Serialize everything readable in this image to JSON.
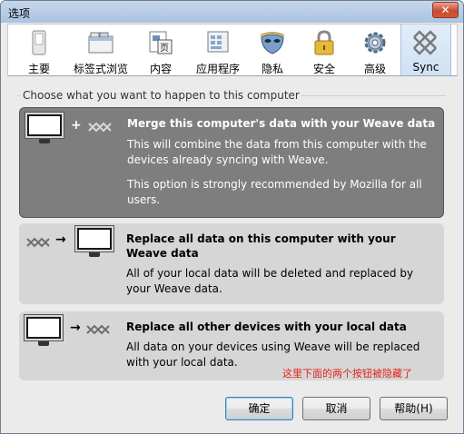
{
  "window": {
    "title": "选项",
    "close_glyph": "✕"
  },
  "toolbar": {
    "tabs": [
      {
        "label": "主要",
        "icon": "switch-icon"
      },
      {
        "label": "标签式浏览",
        "icon": "tabs-window-icon"
      },
      {
        "label": "内容",
        "icon": "content-icon"
      },
      {
        "label": "应用程序",
        "icon": "applications-icon"
      },
      {
        "label": "隐私",
        "icon": "privacy-mask-icon"
      },
      {
        "label": "安全",
        "icon": "padlock-icon"
      },
      {
        "label": "高级",
        "icon": "gear-icon"
      },
      {
        "label": "Sync",
        "icon": "weave-sync-icon"
      }
    ],
    "active_tab": "Sync"
  },
  "group": {
    "label": "Choose what you want to happen to this computer"
  },
  "options": [
    {
      "title": "Merge this computer's data with your Weave data",
      "description_1": "This will combine the data from this computer with the devices already syncing with Weave.",
      "description_2": "This option is strongly recommended by Mozilla for all users.",
      "selected": true,
      "connector": "+"
    },
    {
      "title": "Replace all data on this computer with your Weave data",
      "description_1": "All of your local data will be deleted and replaced by your Weave data.",
      "selected": false,
      "connector": "→"
    },
    {
      "title": "Replace all other devices with your local data",
      "description_1": "All data on your devices using Weave will be replaced with your local data.",
      "selected": false,
      "connector": "→"
    }
  ],
  "annotation": {
    "text": "这里下面的两个按钮被隐藏了"
  },
  "buttons": {
    "ok": "确定",
    "cancel": "取消",
    "help": "帮助(H)"
  },
  "colors": {
    "selected_option": "#7e7e7e",
    "option": "#d6d6d6",
    "annotation": "#e2231a",
    "active_tab": "#cfe1f4"
  }
}
